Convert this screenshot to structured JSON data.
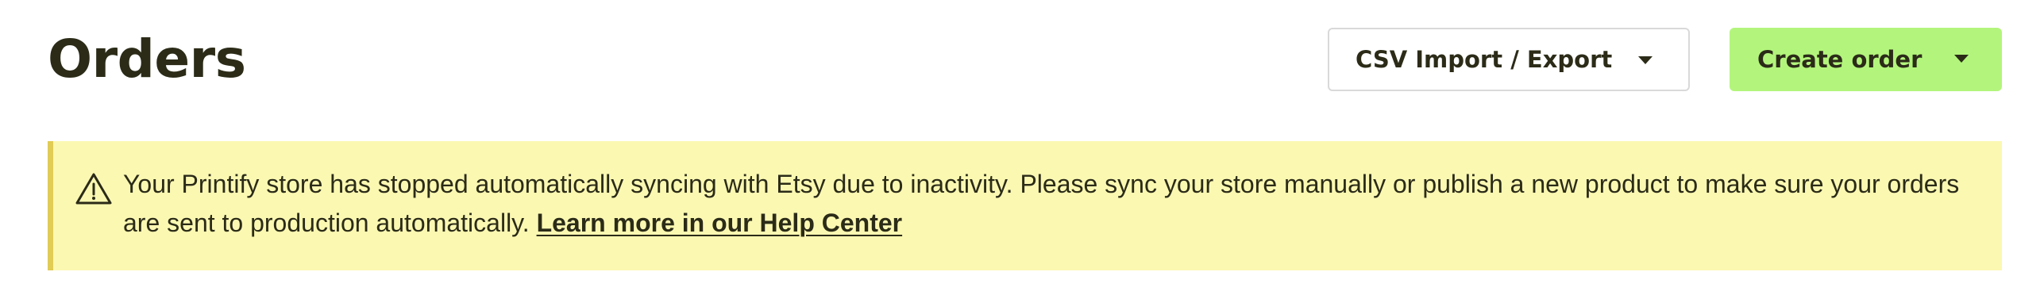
{
  "header": {
    "title": "Orders"
  },
  "actions": {
    "csv_label": "CSV Import / Export",
    "create_label": "Create order"
  },
  "alert": {
    "icon": "warning-triangle-icon",
    "message": "Your Printify store has stopped automatically syncing with Etsy due to inactivity. Please sync your store manually or publish a new product to make sure your orders are sent to production automatically.",
    "link_label": "Learn more in our Help Center"
  },
  "colors": {
    "primary_button": "#b3f57c",
    "alert_background": "#fbf8b2",
    "alert_accent": "#e1cc55",
    "text": "#2b2b18"
  }
}
